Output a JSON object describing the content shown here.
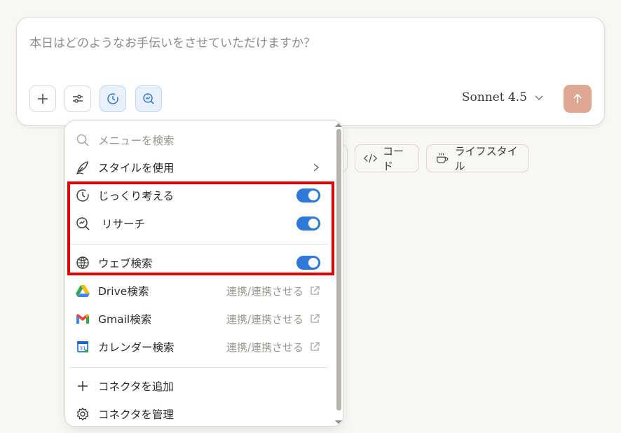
{
  "composer": {
    "placeholder": "本日はどのようなお手伝いをさせていただけますか？",
    "model": "Sonnet 4.5",
    "tools": [
      {
        "name": "add",
        "active": false
      },
      {
        "name": "settings",
        "active": false
      },
      {
        "name": "extended-thinking",
        "active": true
      },
      {
        "name": "research",
        "active": true
      }
    ]
  },
  "chips": {
    "code": "コード",
    "lifestyle": "ライフスタイル"
  },
  "menu": {
    "search_placeholder": "メニューを検索",
    "use_style": "スタイルを使用",
    "thinking": "じっくり考える",
    "research": "リサーチ",
    "web_search": "ウェブ検索",
    "drive": "Drive検索",
    "gmail": "Gmail検索",
    "calendar": "カレンダー検索",
    "connect_label": "連携/連携させる",
    "add_connector": "コネクタを追加",
    "manage_connector": "コネクタを管理",
    "toggles": {
      "thinking": true,
      "research": true,
      "web_search": true
    }
  },
  "colors": {
    "accent": "#2f7ad9",
    "send": "#dfa893",
    "highlight": "#e00000"
  }
}
